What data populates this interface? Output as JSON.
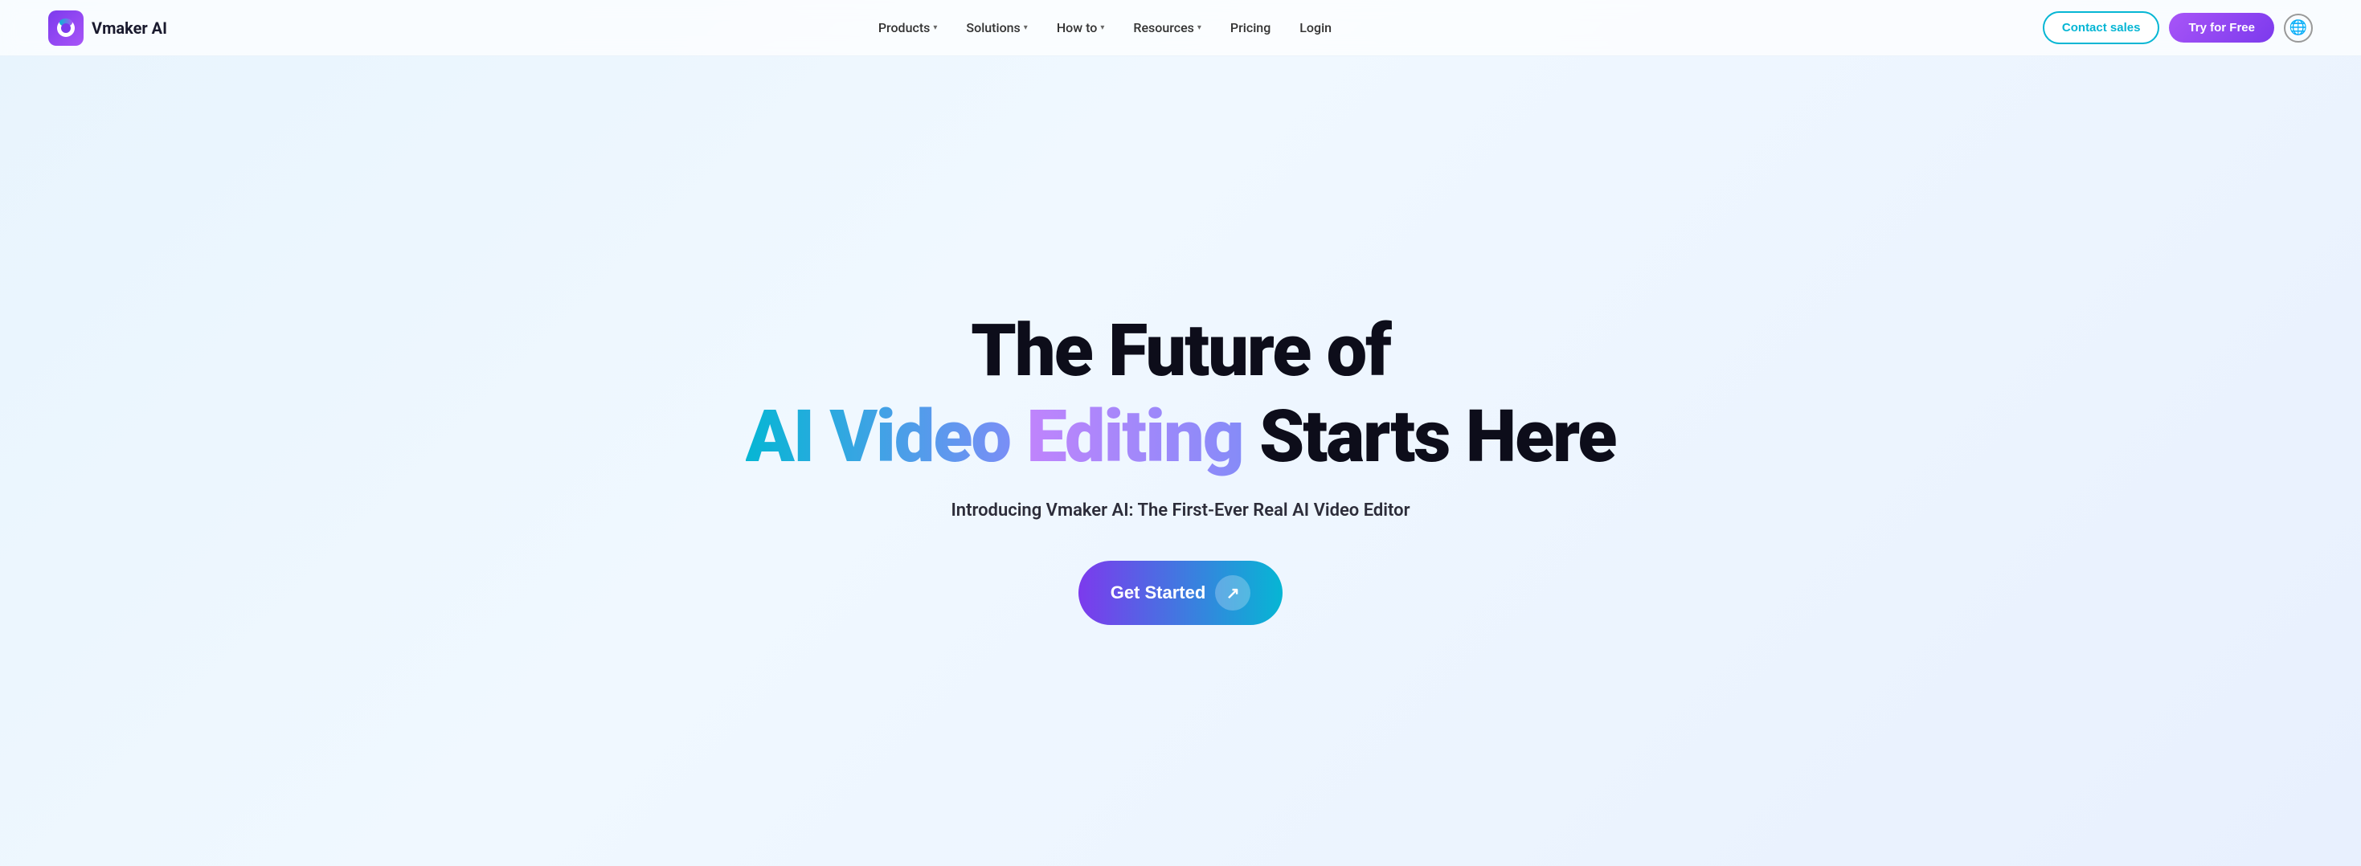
{
  "brand": {
    "name": "Vmaker AI"
  },
  "nav": {
    "items": [
      {
        "label": "Products",
        "has_dropdown": true
      },
      {
        "label": "Solutions",
        "has_dropdown": true
      },
      {
        "label": "How to",
        "has_dropdown": true
      },
      {
        "label": "Resources",
        "has_dropdown": true
      },
      {
        "label": "Pricing",
        "has_dropdown": false
      },
      {
        "label": "Login",
        "has_dropdown": false
      }
    ],
    "contact_label": "Contact sales",
    "try_label": "Try for Free",
    "globe_label": "🌐"
  },
  "hero": {
    "line1": "The Future of",
    "line2_part1": "AI Video",
    "line2_part2": "Editing",
    "line2_part3": "Starts Here",
    "subtitle": "Introducing Vmaker AI: The First-Ever Real AI Video Editor",
    "cta_label": "Get Started",
    "cta_arrow": "↗"
  }
}
